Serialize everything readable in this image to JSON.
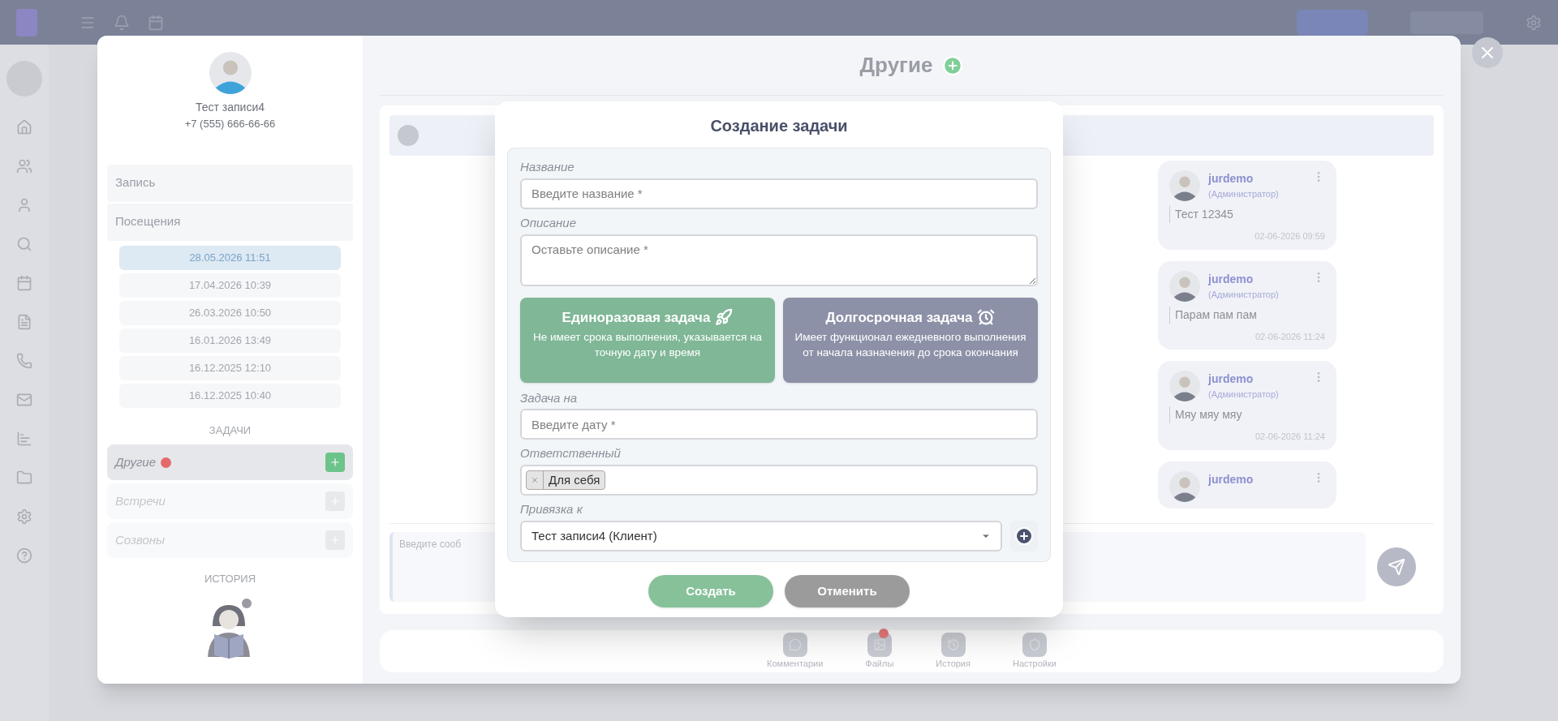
{
  "client": {
    "name": "Тест записи4",
    "phone": "+7 (555) 666-66-66"
  },
  "sections": [
    {
      "label": "Запись"
    },
    {
      "label": "Посещения"
    }
  ],
  "visits": [
    {
      "label": "28.05.2026 11:51",
      "selected": true
    },
    {
      "label": "17.04.2026 10:39",
      "selected": false
    },
    {
      "label": "26.03.2026 10:50",
      "selected": false
    },
    {
      "label": "16.01.2026 13:49",
      "selected": false
    },
    {
      "label": "16.12.2025 12:10",
      "selected": false
    },
    {
      "label": "16.12.2025 10:40",
      "selected": false
    }
  ],
  "tasks_heading": "ЗАДАЧИ",
  "task_categories": [
    {
      "label": "Другие",
      "selected": true,
      "alert": true
    },
    {
      "label": "Встречи",
      "selected": false,
      "alert": false
    },
    {
      "label": "Созвоны",
      "selected": false,
      "alert": false
    }
  ],
  "history_heading": "ИСТОРИЯ",
  "panel": {
    "title": "Другие"
  },
  "messages": [
    {
      "author": "jurdemo",
      "role": "(Администратор)",
      "text": "Тест 12345",
      "time": "02-06-2026 09:59"
    },
    {
      "author": "jurdemo",
      "role": "(Администратор)",
      "text": "Парам пам пам",
      "time": "02-06-2026 11:24"
    },
    {
      "author": "jurdemo",
      "role": "(Администратор)",
      "text": "Мяу мяу мяу",
      "time": "02-06-2026 11:24"
    },
    {
      "author": "jurdemo"
    }
  ],
  "message_input": {
    "placeholder": "Введите сооб"
  },
  "bottom_tabs": [
    {
      "label": "Комментарии",
      "badge": false
    },
    {
      "label": "Файлы",
      "badge": true
    },
    {
      "label": "История",
      "badge": false
    },
    {
      "label": "Настройки",
      "badge": false
    }
  ],
  "dialog": {
    "title": "Создание задачи",
    "name_field": {
      "label": "Название",
      "placeholder": "Введите название *"
    },
    "description_field": {
      "label": "Описание",
      "placeholder": "Оставьте описание *"
    },
    "task_types": [
      {
        "kind": "once",
        "title": "Единоразовая задача",
        "description": "Не имеет срока выполнения, указывается на точную дату и время",
        "color": "#7fb797"
      },
      {
        "kind": "long",
        "title": "Долгосрочная задача",
        "description": "Имеет функционал ежедневного выполнения от начала назначения до срока окончания",
        "color": "#8d91a7"
      }
    ],
    "date_field": {
      "label": "Задача на",
      "placeholder": "Введите дату *"
    },
    "responsible": {
      "label": "Ответственный",
      "tags": [
        "Для себя"
      ]
    },
    "link": {
      "label": "Привязка к",
      "value": "Тест записи4 (Клиент)"
    },
    "buttons": [
      {
        "kind": "primary",
        "label": "Создать"
      },
      {
        "kind": "secondary",
        "label": "Отменить"
      }
    ]
  }
}
